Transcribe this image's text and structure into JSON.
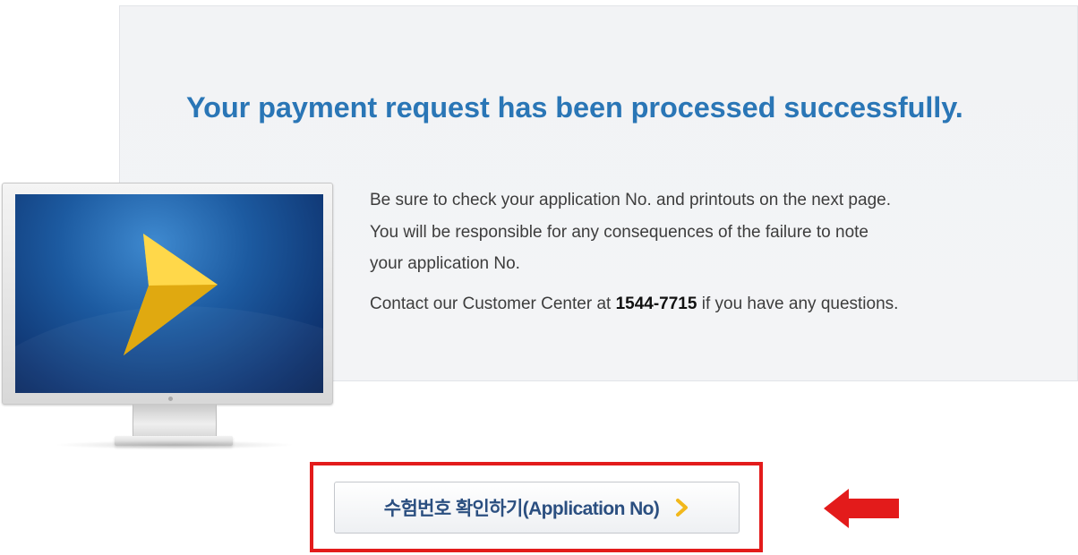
{
  "confirmation": {
    "headline": "Your payment request has been processed successfully.",
    "line1": "Be sure to check your application No. and printouts on the next page.",
    "line2": "You will be responsible for any consequences of the failure to note",
    "line3": "your application No.",
    "contact_prefix": "Contact our Customer Center at ",
    "contact_phone": "1544-7715",
    "contact_suffix": " if you have any questions."
  },
  "action": {
    "button_label": "수험번호 확인하기(Application No)",
    "button_icon": "chevron-right-icon"
  },
  "illustration": {
    "name": "monitor-illustration",
    "screen_icon": "play-chevron-icon"
  },
  "annotations": {
    "highlight_box": "red-highlight-box",
    "pointer": "red-left-arrow"
  },
  "colors": {
    "headline": "#2a76b6",
    "body_text": "#3d3d3d",
    "button_text": "#2b4f80",
    "button_chevron": "#f2b81c",
    "highlight": "#e31b1b",
    "screen_chevron": "#f4c21e"
  }
}
